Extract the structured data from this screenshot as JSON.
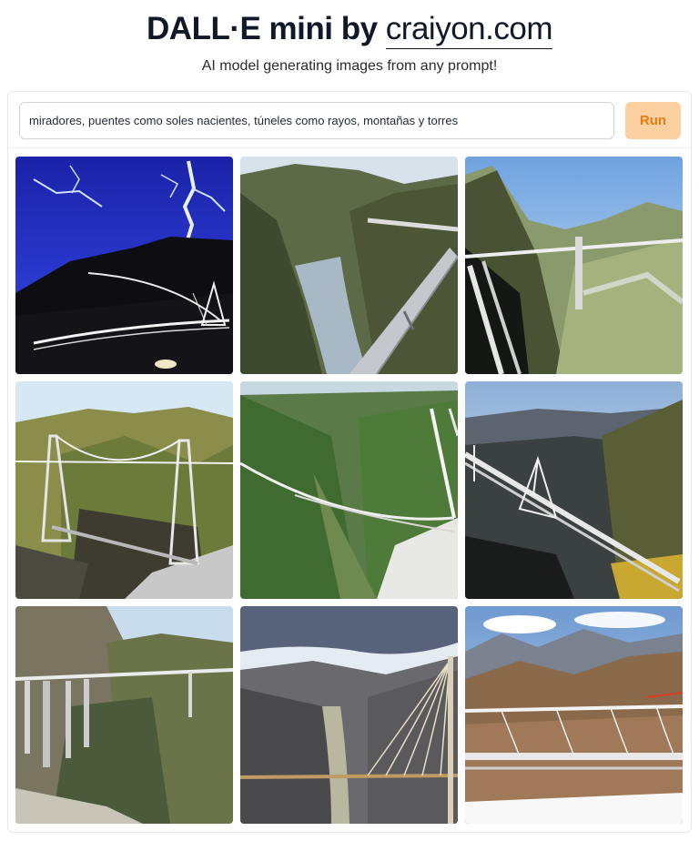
{
  "header": {
    "title_prefix": "DALL·E mini by ",
    "title_link": "craiyon.com",
    "subtitle": "AI model generating images from any prompt!"
  },
  "prompt": {
    "value": "miradores, puentes como soles nacientes, túneles como rayos, montañas y torres",
    "run_label": "Run"
  },
  "results": [
    {
      "scene": "night-lightning-bridge"
    },
    {
      "scene": "canyon-river-bridge"
    },
    {
      "scene": "mountain-tower-bridge"
    },
    {
      "scene": "twin-tower-suspension-bridge"
    },
    {
      "scene": "green-valley-cable-bridge"
    },
    {
      "scene": "cable-stayed-bridge-valley"
    },
    {
      "scene": "gorge-viaduct"
    },
    {
      "scene": "cloudy-valley-cable-bridge"
    },
    {
      "scene": "snowy-mountains-bridge"
    }
  ],
  "colors": {
    "run_bg": "#fdd0a2",
    "run_text": "#ea7a12",
    "border": "#e5e7eb"
  }
}
